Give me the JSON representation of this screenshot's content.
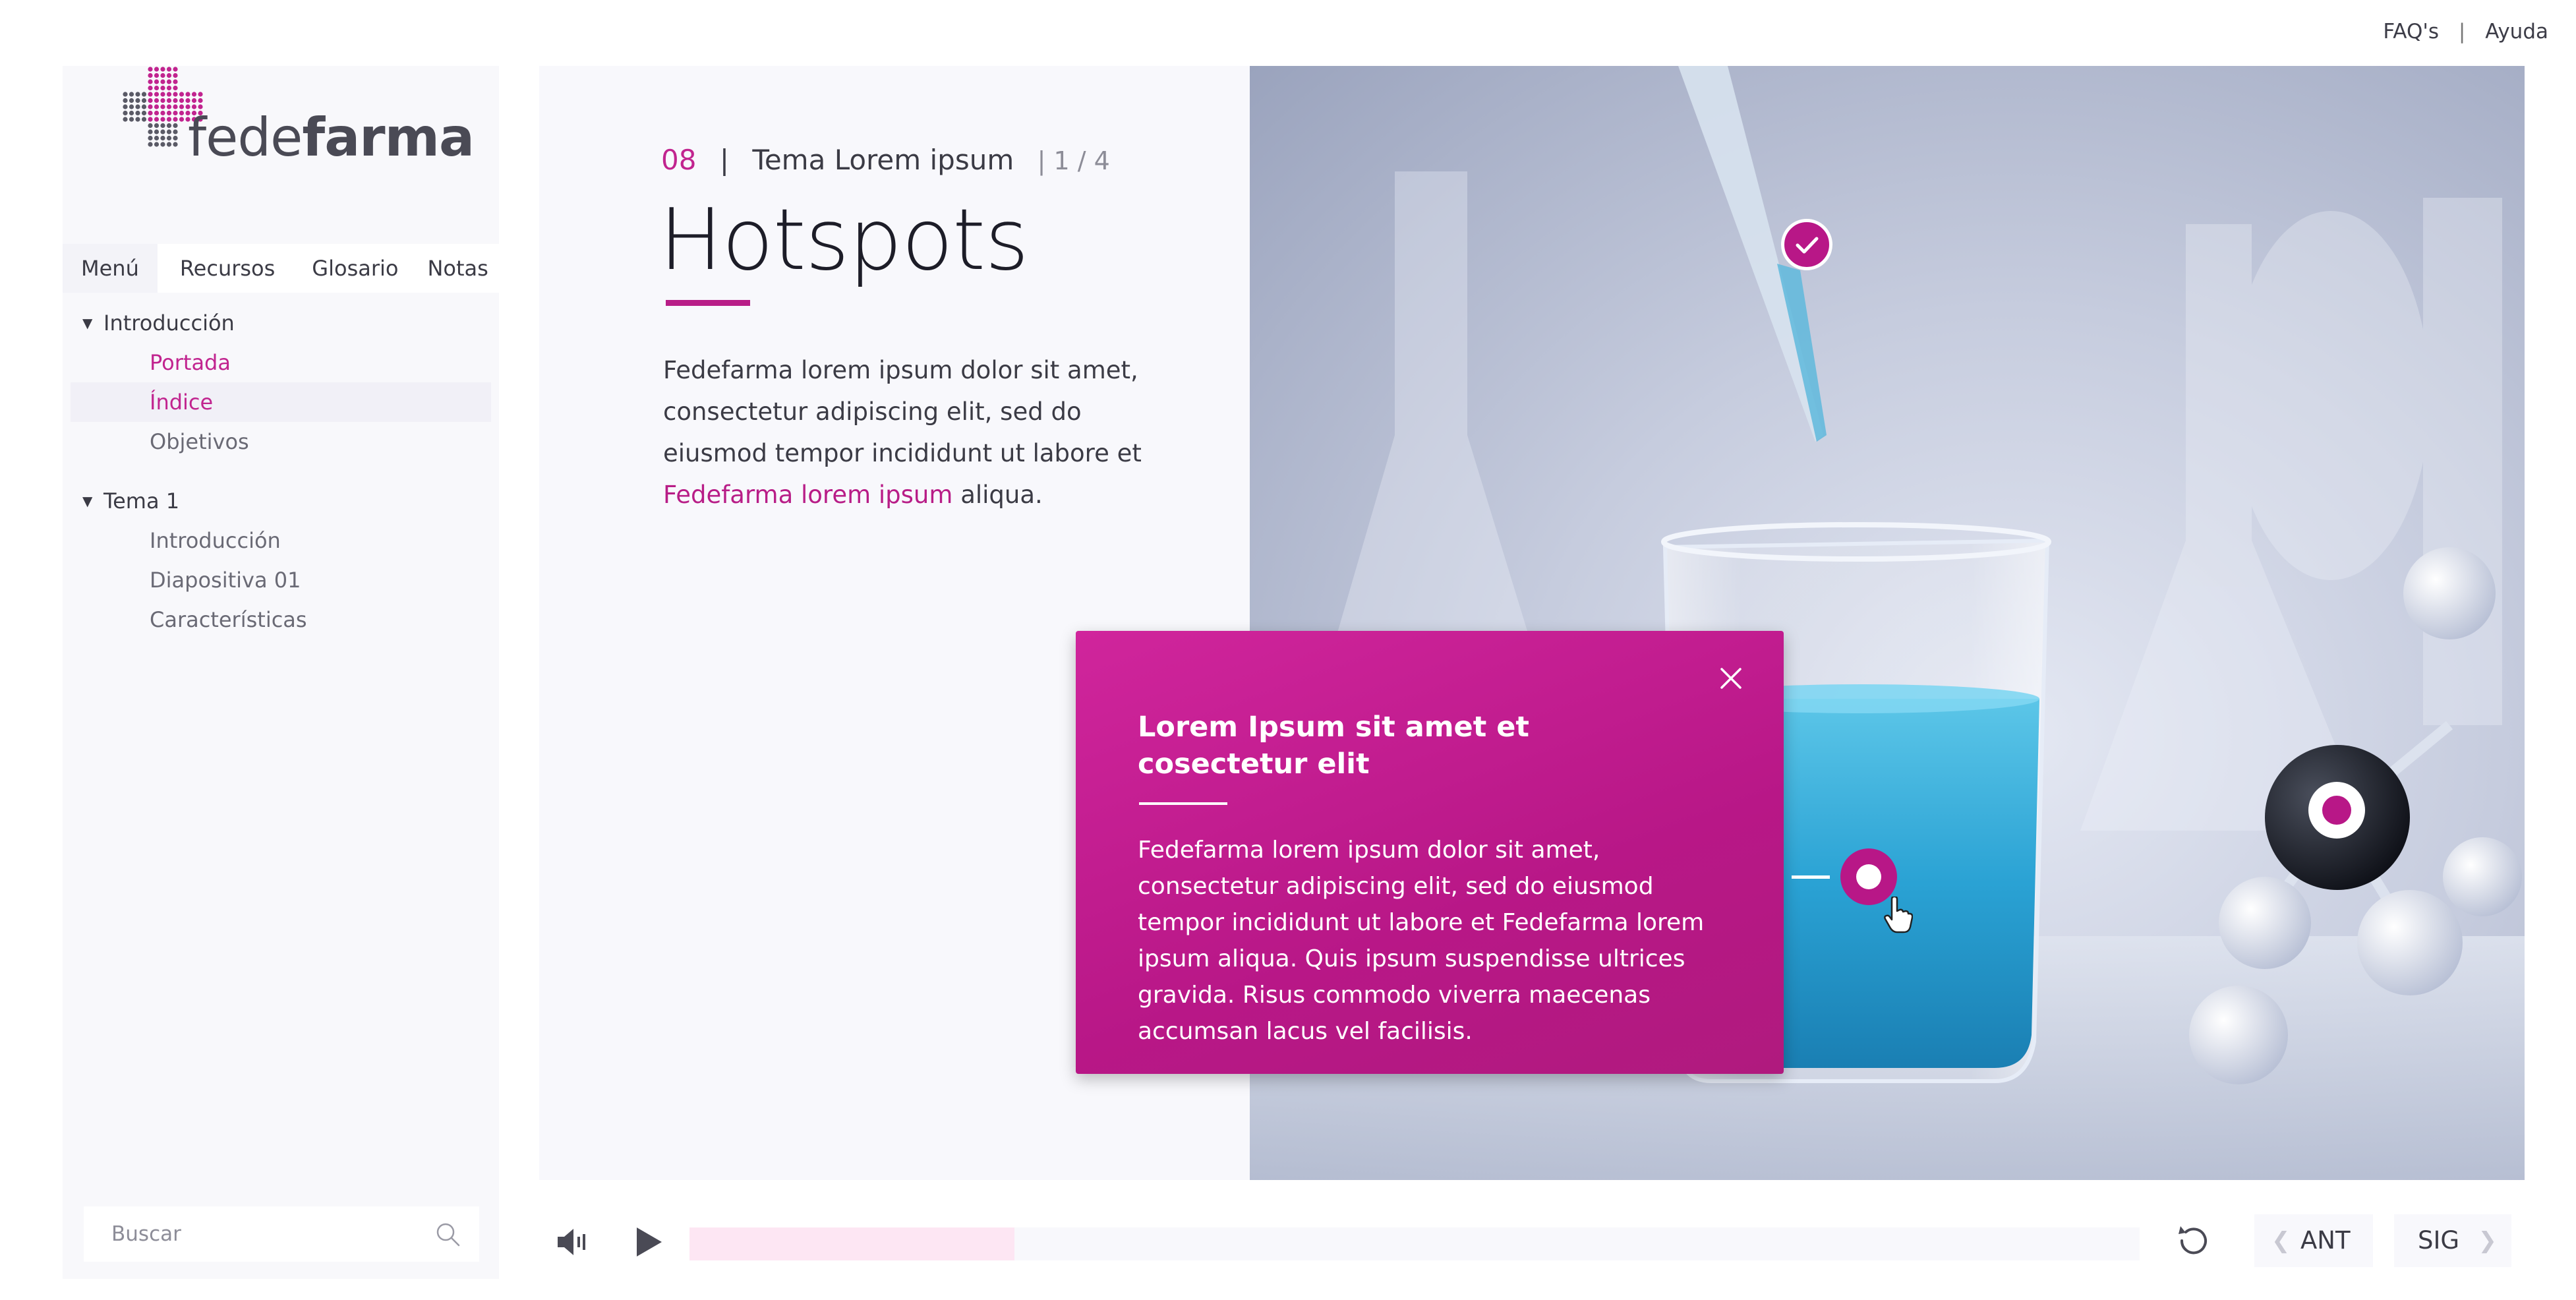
{
  "header": {
    "faq_label": "FAQ's",
    "separator": "|",
    "help_label": "Ayuda"
  },
  "brand": {
    "logo_light": "fede",
    "logo_bold": "farma",
    "accent_color": "#b81787",
    "logo_dot_colors": [
      "#5a5a66",
      "#c1248f"
    ]
  },
  "sidebar": {
    "tabs": [
      {
        "label": "Menú",
        "active": true
      },
      {
        "label": "Recursos",
        "active": false
      },
      {
        "label": "Glosario",
        "active": false
      },
      {
        "label": "Notas",
        "active": false
      }
    ],
    "groups": [
      {
        "label": "Introducción",
        "expanded": true,
        "items": [
          {
            "label": "Portada",
            "state": "visited"
          },
          {
            "label": "Índice",
            "state": "selected"
          },
          {
            "label": "Objetivos",
            "state": "default"
          }
        ]
      },
      {
        "label": "Tema 1",
        "expanded": true,
        "items": [
          {
            "label": "Introducción",
            "state": "default"
          },
          {
            "label": "Diapositiva 01",
            "state": "default"
          },
          {
            "label": "Características",
            "state": "default"
          }
        ]
      }
    ],
    "search_placeholder": "Buscar",
    "search_icon": "search-icon"
  },
  "slide": {
    "number": "08",
    "separator": "|",
    "topic": "Tema Lorem ipsum",
    "page": "| 1 / 4",
    "title": "Hotspots",
    "body_before": "Fedefarma lorem ipsum dolor sit amet, consectetur adipiscing elit, sed do eiusmod tempor incididunt ut labore et ",
    "body_highlight": "Fedefarma lorem ipsum",
    "body_after": " aliqua."
  },
  "popup": {
    "title": "Lorem Ipsum sit amet et cosectetur elit",
    "text": "Fedefarma lorem ipsum dolor sit amet, consectetur adipiscing elit, sed do eiusmod tempor incididunt ut labore et Fedefarma lorem ipsum aliqua. Quis ipsum suspendisse ultrices gravida. Risus commodo viverra maecenas accumsan lacus vel facilisis.",
    "close_icon": "close-icon"
  },
  "hotspots": [
    {
      "name": "pipette",
      "state": "visited"
    },
    {
      "name": "beaker",
      "state": "active"
    },
    {
      "name": "molecule",
      "state": "unvisited"
    }
  ],
  "player": {
    "volume_icon": "volume-icon",
    "play_icon": "play-icon",
    "progress_fraction": 0.224,
    "reload_icon": "reload-icon",
    "prev_label": "ANT",
    "next_label": "SIG"
  }
}
